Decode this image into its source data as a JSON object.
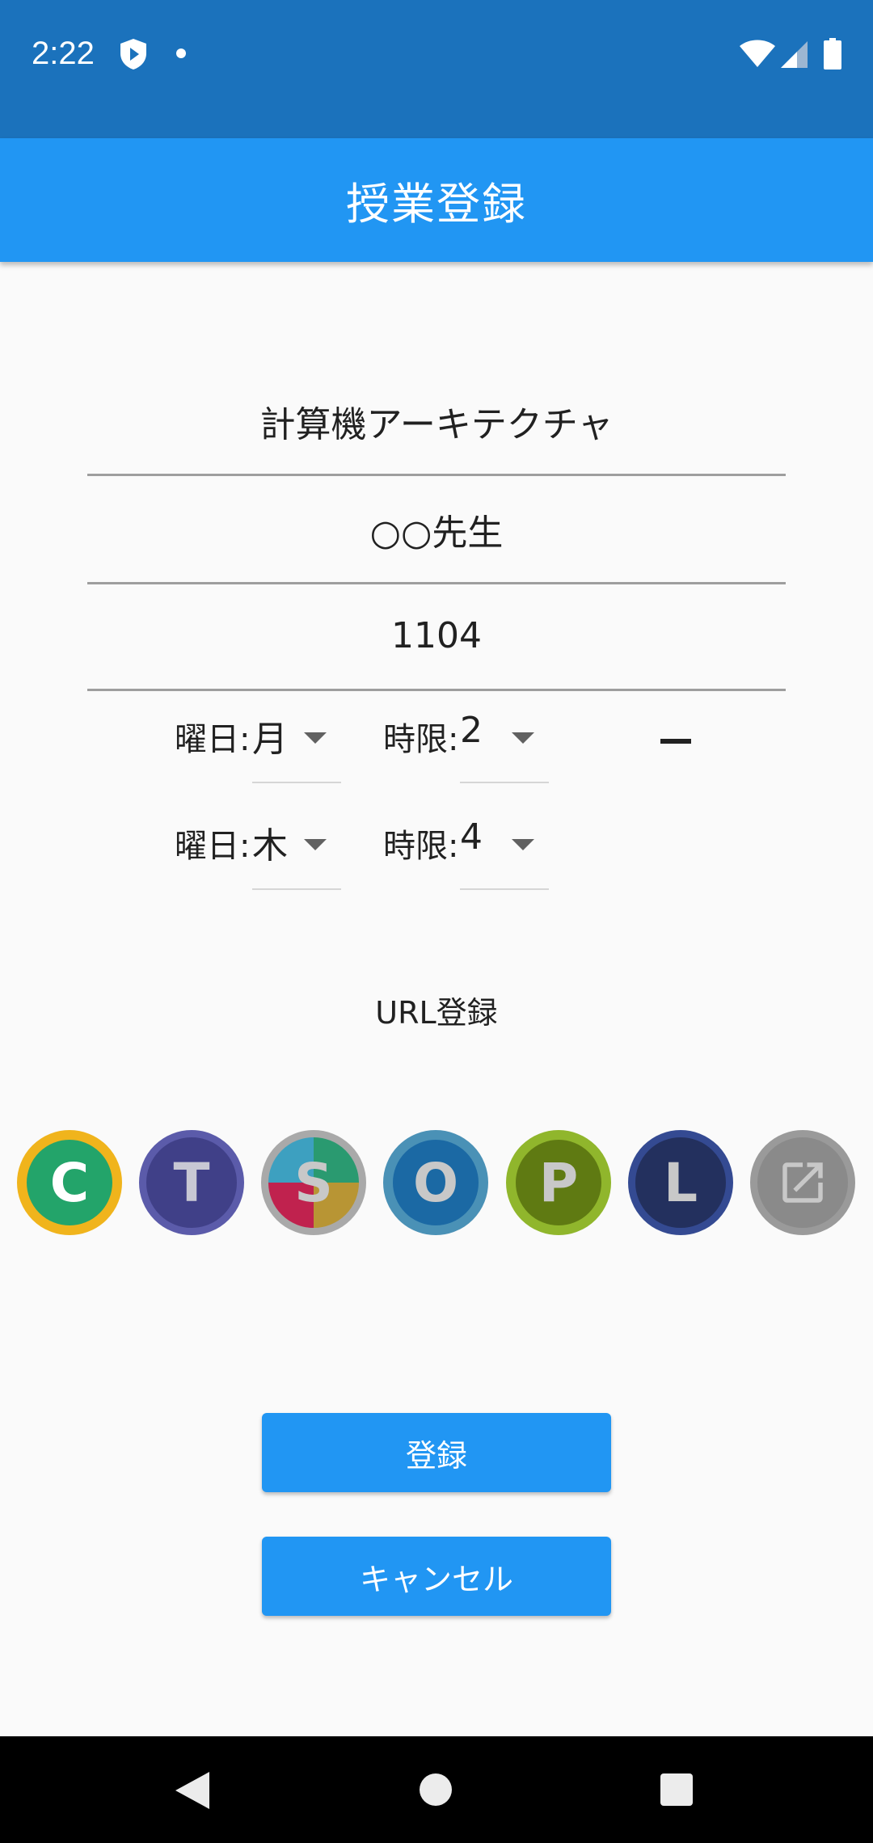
{
  "status_bar": {
    "time": "2:22",
    "icons": [
      "shield-play-icon",
      "notification-dot-icon",
      "wifi-icon",
      "cell-signal-icon",
      "battery-icon"
    ]
  },
  "app_bar": {
    "title": "授業登録"
  },
  "form": {
    "course_name": "計算機アーキテクチャ",
    "teacher": "○○先生",
    "room": "1104"
  },
  "schedule": [
    {
      "day_label": "曜日:",
      "day_value": "月",
      "period_label": "時限:",
      "period_value": "2",
      "has_remove": true
    },
    {
      "day_label": "曜日:",
      "day_value": "木",
      "period_label": "時限:",
      "period_value": "4",
      "has_remove": false
    }
  ],
  "url_section": {
    "label": "URL登録"
  },
  "url_icons": [
    {
      "letter": "C",
      "name": "c-service-icon",
      "ring": "#f0b41c",
      "fill": "#23a46a",
      "text": "#ffffff"
    },
    {
      "letter": "T",
      "name": "t-service-icon",
      "ring": "#5b5baa",
      "fill": "#404088",
      "text": "#c8c8d4"
    },
    {
      "letter": "S",
      "name": "s-service-icon",
      "ring": "#a9a9a9",
      "fill": "multicolor",
      "text": "#c8c8c8"
    },
    {
      "letter": "O",
      "name": "o-service-icon",
      "ring": "#4a91b6",
      "fill": "#1b69a4",
      "text": "#c8c8c8"
    },
    {
      "letter": "P",
      "name": "p-service-icon",
      "ring": "#90b62c",
      "fill": "#5f7a12",
      "text": "#c8c8c8"
    },
    {
      "letter": "L",
      "name": "l-service-icon",
      "ring": "#344a92",
      "fill": "#23305e",
      "text": "#c8c8c8"
    },
    {
      "letter": "",
      "name": "external-link-icon",
      "ring": "#9a9a9a",
      "fill": "#8a8a8a",
      "text": "#c8c8c8"
    }
  ],
  "buttons": {
    "register": "登録",
    "cancel": "キャンセル"
  },
  "colors": {
    "status_bar": "#1b72bc",
    "app_bar": "#2196f3",
    "button": "#2196f3"
  }
}
